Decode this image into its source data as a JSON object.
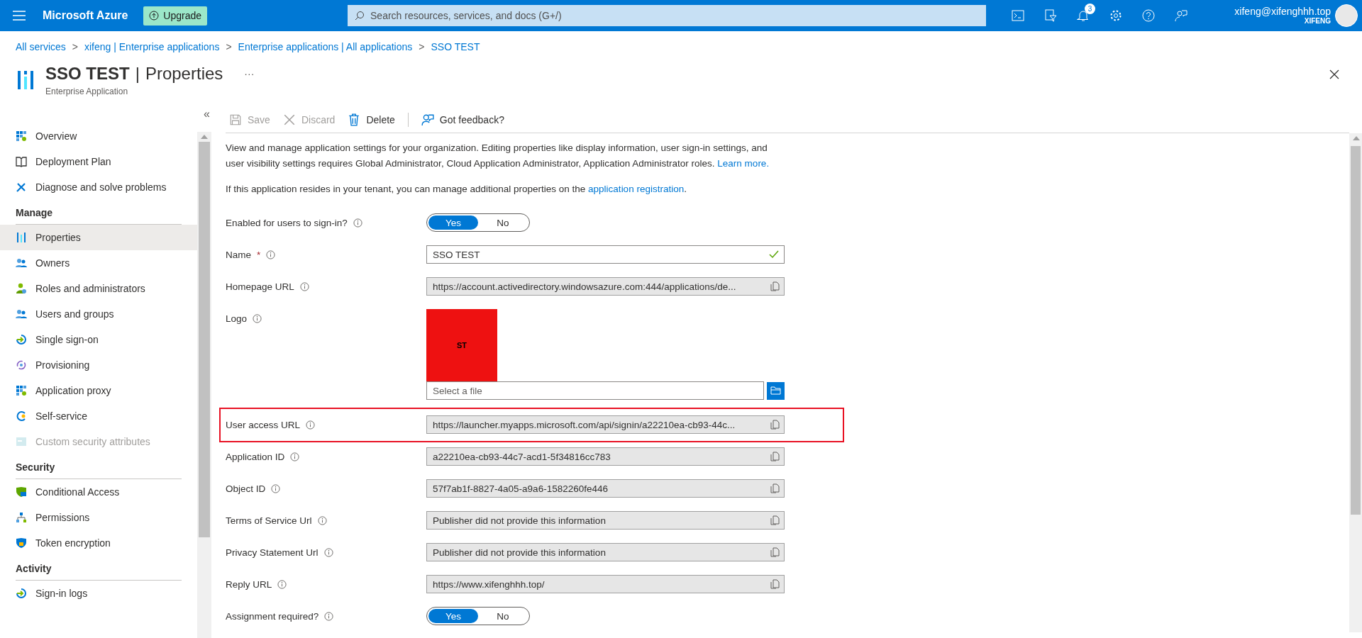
{
  "top_bar": {
    "brand": "Microsoft Azure",
    "upgrade": "Upgrade",
    "search": {
      "placeholder": "Search resources, services, and docs (G+/)"
    },
    "notifications_count": "3",
    "user": {
      "email": "xifeng@xifenghhh.top",
      "tenant": "XIFENG"
    }
  },
  "breadcrumb": [
    "All services",
    "xifeng | Enterprise applications",
    "Enterprise applications | All applications",
    "SSO TEST"
  ],
  "breadcrumb_separator": ">",
  "header": {
    "title": "SSO TEST",
    "subtitle_part": "Properties",
    "title_separator": "|",
    "kind_label": "Enterprise Application",
    "more": "···"
  },
  "sidebar": {
    "collapse": "«",
    "sections": [
      {
        "items": [
          {
            "label": "Overview",
            "selected": false,
            "disabled": false
          },
          {
            "label": "Deployment Plan",
            "selected": false,
            "disabled": false
          },
          {
            "label": "Diagnose and solve problems",
            "selected": false,
            "disabled": false
          }
        ]
      },
      {
        "heading": "Manage",
        "items": [
          {
            "label": "Properties",
            "selected": true,
            "disabled": false
          },
          {
            "label": "Owners",
            "selected": false,
            "disabled": false
          },
          {
            "label": "Roles and administrators",
            "selected": false,
            "disabled": false
          },
          {
            "label": "Users and groups",
            "selected": false,
            "disabled": false
          },
          {
            "label": "Single sign-on",
            "selected": false,
            "disabled": false
          },
          {
            "label": "Provisioning",
            "selected": false,
            "disabled": false
          },
          {
            "label": "Application proxy",
            "selected": false,
            "disabled": false
          },
          {
            "label": "Self-service",
            "selected": false,
            "disabled": false
          },
          {
            "label": "Custom security attributes",
            "selected": false,
            "disabled": true
          }
        ]
      },
      {
        "heading": "Security",
        "items": [
          {
            "label": "Conditional Access",
            "selected": false,
            "disabled": false
          },
          {
            "label": "Permissions",
            "selected": false,
            "disabled": false
          },
          {
            "label": "Token encryption",
            "selected": false,
            "disabled": false
          }
        ]
      },
      {
        "heading": "Activity",
        "items": [
          {
            "label": "Sign-in logs",
            "selected": false,
            "disabled": false
          }
        ]
      }
    ]
  },
  "toolbar": [
    {
      "label": "Save",
      "disabled": true
    },
    {
      "label": "Discard",
      "disabled": true
    },
    {
      "label": "Delete",
      "disabled": false
    },
    {
      "label": "Got feedback?",
      "disabled": false
    }
  ],
  "intro": {
    "text": "View and manage application settings for your organization. Editing properties like display information, user sign-in settings, and user visibility settings requires Global Administrator, Cloud Application Administrator, Application Administrator roles.",
    "link": "Learn more."
  },
  "tenant_note": {
    "text": "If this application resides in your tenant, you can manage additional properties on the",
    "link": "application registration",
    "end": "."
  },
  "fields": [
    {
      "kind": "toggle",
      "label": "Enabled for users to sign-in?",
      "options": [
        {
          "label": "Yes",
          "selected": true
        },
        {
          "label": "No",
          "selected": false
        }
      ]
    },
    {
      "kind": "input",
      "label": "Name",
      "required_mark": "*",
      "value": "SSO TEST",
      "valid": true
    },
    {
      "kind": "readonly",
      "label": "Homepage URL",
      "value": "https://account.activedirectory.windowsazure.com:444/applications/de...",
      "highlighted": false
    },
    {
      "kind": "logo",
      "label": "Logo",
      "logo_text": "ST",
      "placeholder": "Select a file"
    },
    {
      "kind": "readonly",
      "label": "User access URL",
      "value": "https://launcher.myapps.microsoft.com/api/signin/a22210ea-cb93-44c...",
      "highlighted": true
    },
    {
      "kind": "readonly",
      "label": "Application ID",
      "value": "a22210ea-cb93-44c7-acd1-5f34816cc783",
      "highlighted": false
    },
    {
      "kind": "readonly",
      "label": "Object ID",
      "value": "57f7ab1f-8827-4a05-a9a6-1582260fe446",
      "highlighted": false
    },
    {
      "kind": "readonly",
      "label": "Terms of Service Url",
      "value": "Publisher did not provide this information",
      "highlighted": false
    },
    {
      "kind": "readonly",
      "label": "Privacy Statement Url",
      "value": "Publisher did not provide this information",
      "highlighted": false
    },
    {
      "kind": "readonly",
      "label": "Reply URL",
      "value": "https://www.xifenghhh.top/",
      "highlighted": false
    },
    {
      "kind": "toggle",
      "label": "Assignment required?",
      "options": [
        {
          "label": "Yes",
          "selected": true
        },
        {
          "label": "No",
          "selected": false
        }
      ]
    }
  ]
}
